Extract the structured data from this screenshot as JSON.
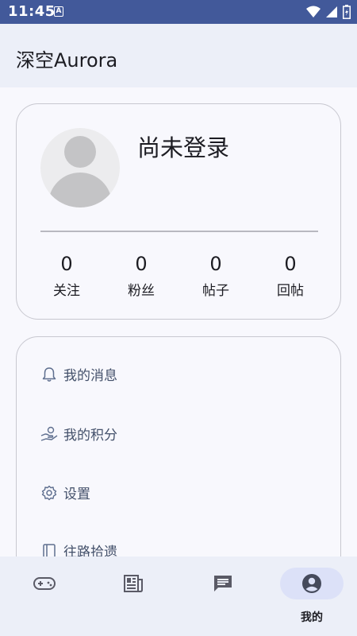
{
  "status_bar": {
    "time": "11:45",
    "a_icon": "A"
  },
  "app_bar": {
    "title": "深空Aurora"
  },
  "profile": {
    "status": "尚未登录",
    "stats": [
      {
        "value": "0",
        "label": "关注"
      },
      {
        "value": "0",
        "label": "粉丝"
      },
      {
        "value": "0",
        "label": "帖子"
      },
      {
        "value": "0",
        "label": "回帖"
      }
    ]
  },
  "menu": {
    "items": [
      {
        "label": "我的消息",
        "icon": "bell-icon"
      },
      {
        "label": "我的积分",
        "icon": "points-icon"
      },
      {
        "label": "设置",
        "icon": "gear-icon"
      },
      {
        "label": "往路拾遗",
        "icon": "book-icon"
      }
    ]
  },
  "bottom_nav": {
    "items": [
      {
        "icon": "gamepad-icon",
        "label": ""
      },
      {
        "icon": "newspaper-icon",
        "label": ""
      },
      {
        "icon": "chat-icon",
        "label": ""
      },
      {
        "icon": "account-icon",
        "label": "我的"
      }
    ],
    "active_index": 3
  },
  "colors": {
    "status_bar": "#42599a",
    "app_bar": "#eceff8",
    "active_pill": "#dce1f8",
    "menu_text": "#43506a"
  }
}
